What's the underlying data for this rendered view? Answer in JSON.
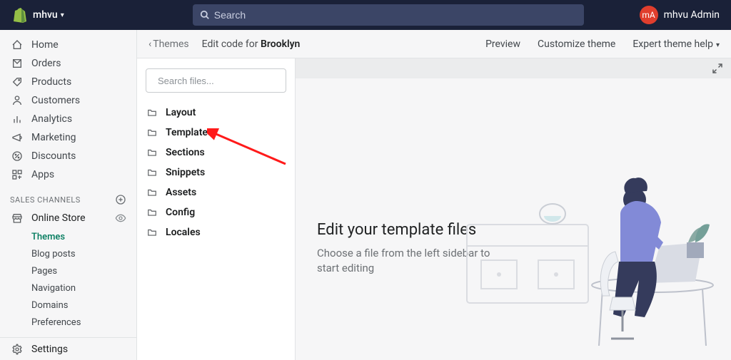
{
  "topbar": {
    "store_name": "mhvu",
    "search_placeholder": "Search",
    "avatar_initials": "mA",
    "user_name": "mhvu Admin"
  },
  "sidebar": {
    "items": [
      {
        "label": "Home"
      },
      {
        "label": "Orders"
      },
      {
        "label": "Products"
      },
      {
        "label": "Customers"
      },
      {
        "label": "Analytics"
      },
      {
        "label": "Marketing"
      },
      {
        "label": "Discounts"
      },
      {
        "label": "Apps"
      }
    ],
    "section_label": "SALES CHANNELS",
    "online_store_label": "Online Store",
    "sub_items": [
      {
        "label": "Themes"
      },
      {
        "label": "Blog posts"
      },
      {
        "label": "Pages"
      },
      {
        "label": "Navigation"
      },
      {
        "label": "Domains"
      },
      {
        "label": "Preferences"
      }
    ],
    "settings_label": "Settings"
  },
  "breadcrumb": {
    "back_label": "Themes",
    "title_prefix": "Edit code for ",
    "title_theme": "Brooklyn",
    "links": {
      "preview": "Preview",
      "customize": "Customize theme",
      "help": "Expert theme help"
    }
  },
  "file_panel": {
    "search_placeholder": "Search files...",
    "folders": [
      {
        "label": "Layout"
      },
      {
        "label": "Templates"
      },
      {
        "label": "Sections"
      },
      {
        "label": "Snippets"
      },
      {
        "label": "Assets"
      },
      {
        "label": "Config"
      },
      {
        "label": "Locales"
      }
    ]
  },
  "editor": {
    "empty_title": "Edit your template files",
    "empty_sub": "Choose a file from the left sidebar to start editing"
  }
}
